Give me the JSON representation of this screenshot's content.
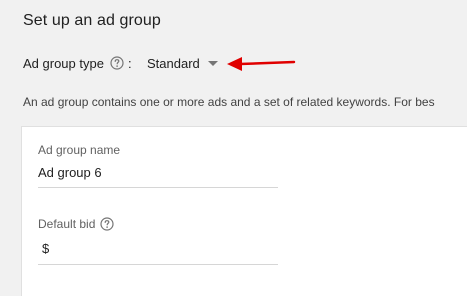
{
  "page": {
    "title": "Set up an ad group"
  },
  "ad_group_type": {
    "label": "Ad group type",
    "colon": ":",
    "help_icon": "question-circle-icon",
    "selected": "Standard",
    "dropdown_icon": "caret-down-icon"
  },
  "annotation": {
    "arrow_color": "#e00000",
    "icon": "red-arrow-icon"
  },
  "description": "An ad group contains one or more ads and a set of related keywords. For bes",
  "form": {
    "ad_group_name": {
      "label": "Ad group name",
      "value": "Ad group 6"
    },
    "default_bid": {
      "label": "Default bid",
      "help_icon": "question-circle-icon",
      "value": "$"
    }
  },
  "colors": {
    "background": "#f1f1f1",
    "card": "#ffffff",
    "text": "#212121",
    "secondary_text": "#616161"
  }
}
